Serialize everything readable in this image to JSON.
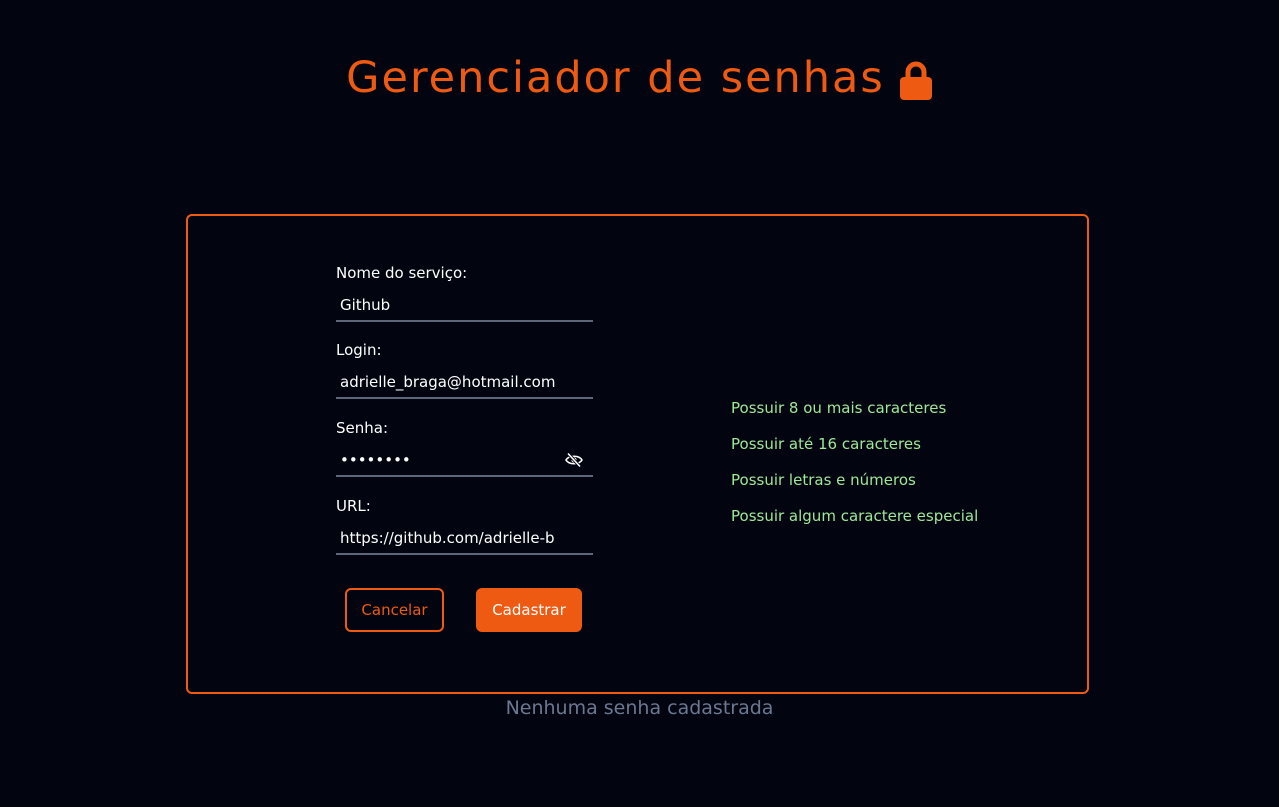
{
  "header": {
    "title": "Gerenciador de senhas",
    "icon": "lock-icon",
    "accent_color": "#ee5a12"
  },
  "form": {
    "service": {
      "label": "Nome do serviço:",
      "value": "Github"
    },
    "login": {
      "label": "Login:",
      "value": "adrielle_braga@hotmail.com"
    },
    "password": {
      "label": "Senha:",
      "value": "••••••••",
      "toggle_icon": "eye-off-icon"
    },
    "url": {
      "label": "URL:",
      "value": "https://github.com/adrielle-b"
    },
    "cancel_label": "Cancelar",
    "submit_label": "Cadastrar"
  },
  "validation": {
    "color": "#9ee89a",
    "rules": [
      "Possuir 8 ou mais caracteres",
      "Possuir até 16 caracteres",
      "Possuir letras e números",
      "Possuir algum caractere especial"
    ]
  },
  "empty_message": "Nenhuma senha cadastrada"
}
